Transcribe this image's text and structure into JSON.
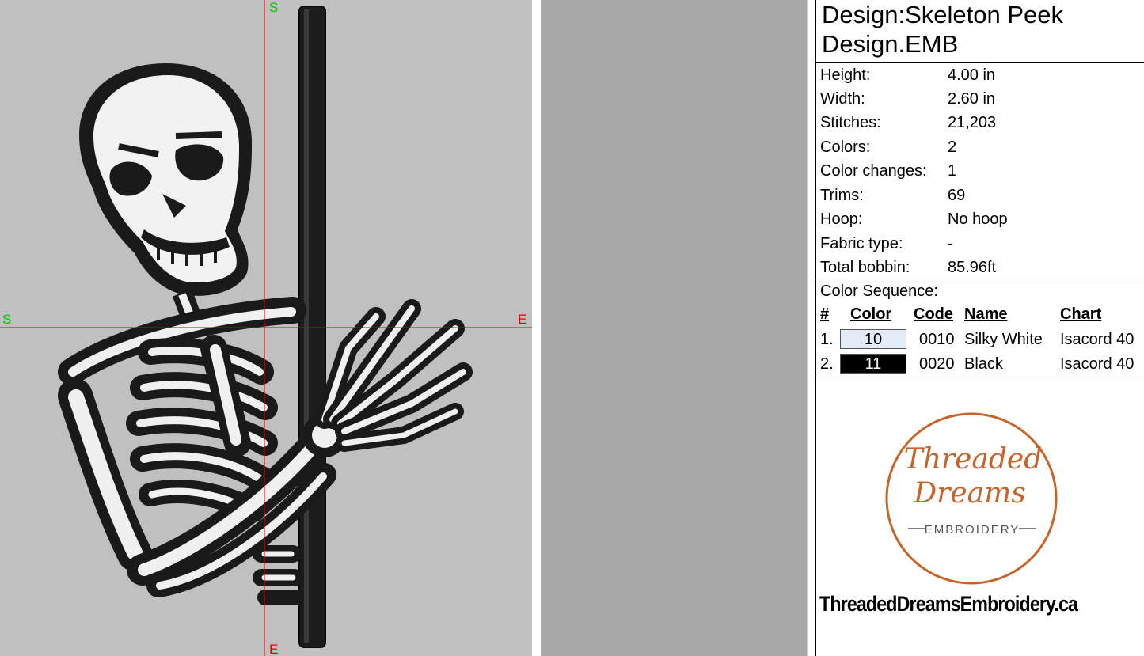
{
  "preview": {
    "axis_letters": {
      "top": "S",
      "bottom": "E",
      "left": "S",
      "right": "E"
    }
  },
  "design": {
    "title_line1": "Design:Skeleton Peek",
    "title_line2": "Design.EMB"
  },
  "stats": [
    {
      "label": "Height:",
      "value": "4.00 in"
    },
    {
      "label": "Width:",
      "value": "2.60 in"
    },
    {
      "label": "Stitches:",
      "value": "21,203"
    },
    {
      "label": "Colors:",
      "value": "2"
    },
    {
      "label": "Color changes:",
      "value": "1"
    },
    {
      "label": "Trims:",
      "value": "69"
    },
    {
      "label": "Hoop:",
      "value": "No hoop"
    },
    {
      "label": "Fabric type:",
      "value": "-"
    },
    {
      "label": "Total bobbin:",
      "value": "85.96ft"
    }
  ],
  "color_sequence": {
    "title": "Color Sequence:",
    "headers": {
      "num": "#",
      "color": "Color",
      "code": "Code",
      "name": "Name",
      "chart": "Chart"
    },
    "rows": [
      {
        "num": "1.",
        "color": "10",
        "code": "0010",
        "name": "Silky White",
        "chart": "Isacord 40",
        "swatch_hex": "#e4ecfa",
        "text_hex": "#000000"
      },
      {
        "num": "2.",
        "color": "11",
        "code": "0020",
        "name": "Black",
        "chart": "Isacord 40",
        "swatch_hex": "#000000",
        "text_hex": "#ffffff"
      }
    ]
  },
  "logo": {
    "line1": "Threaded",
    "line2": "Dreams",
    "line3": "EMBROIDERY",
    "accent": "#c8642a"
  },
  "website": "ThreadedDreamsEmbroidery.ca"
}
